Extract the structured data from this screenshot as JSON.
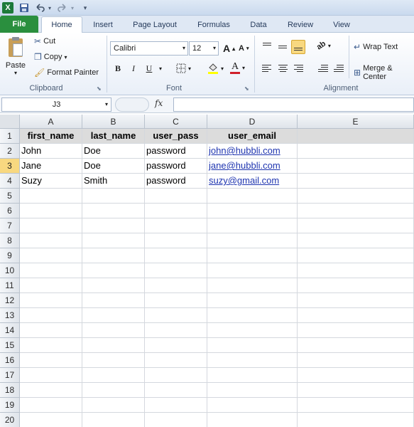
{
  "quick_access": {
    "excel_icon": "X",
    "save_icon": "save-icon",
    "undo_icon": "undo-icon",
    "redo_icon": "redo-icon",
    "customize_icon": "customize-icon"
  },
  "tabs": [
    "File",
    "Home",
    "Insert",
    "Page Layout",
    "Formulas",
    "Data",
    "Review",
    "View"
  ],
  "ribbon": {
    "clipboard": {
      "paste": "Paste",
      "cut": "Cut",
      "copy": "Copy",
      "format_painter": "Format Painter",
      "label": "Clipboard"
    },
    "font": {
      "family": "Calibri",
      "size": "12",
      "bold": "B",
      "italic": "I",
      "underline": "U",
      "font_color_glyph": "A",
      "label": "Font"
    },
    "alignment": {
      "wrap_text": "Wrap Text",
      "merge": "Merge & Center",
      "label": "Alignment"
    }
  },
  "formula_bar": {
    "name_box": "J3",
    "fx": "fx",
    "value": ""
  },
  "sheet": {
    "columns": [
      "A",
      "B",
      "C",
      "D",
      "E"
    ],
    "rows": [
      "1",
      "2",
      "3",
      "4",
      "5",
      "6",
      "7",
      "8",
      "9",
      "10",
      "11",
      "12",
      "13",
      "14",
      "15",
      "16",
      "17",
      "18",
      "19",
      "20"
    ],
    "selected_row": "3",
    "header": [
      "first_name",
      "last_name",
      "user_pass",
      "user_email"
    ],
    "data": [
      [
        "John",
        "Doe",
        "password",
        "john@hubbli.com"
      ],
      [
        "Jane",
        "Doe",
        "password",
        "jane@hubbli.com"
      ],
      [
        "Suzy",
        "Smith",
        "password",
        "suzy@gmail.com"
      ]
    ]
  },
  "colors": {
    "file_tab": "#2a8f3e",
    "selected_row_header": "#f8d880",
    "link": "#1f35b0",
    "header_fill": "#dcdcdc"
  }
}
